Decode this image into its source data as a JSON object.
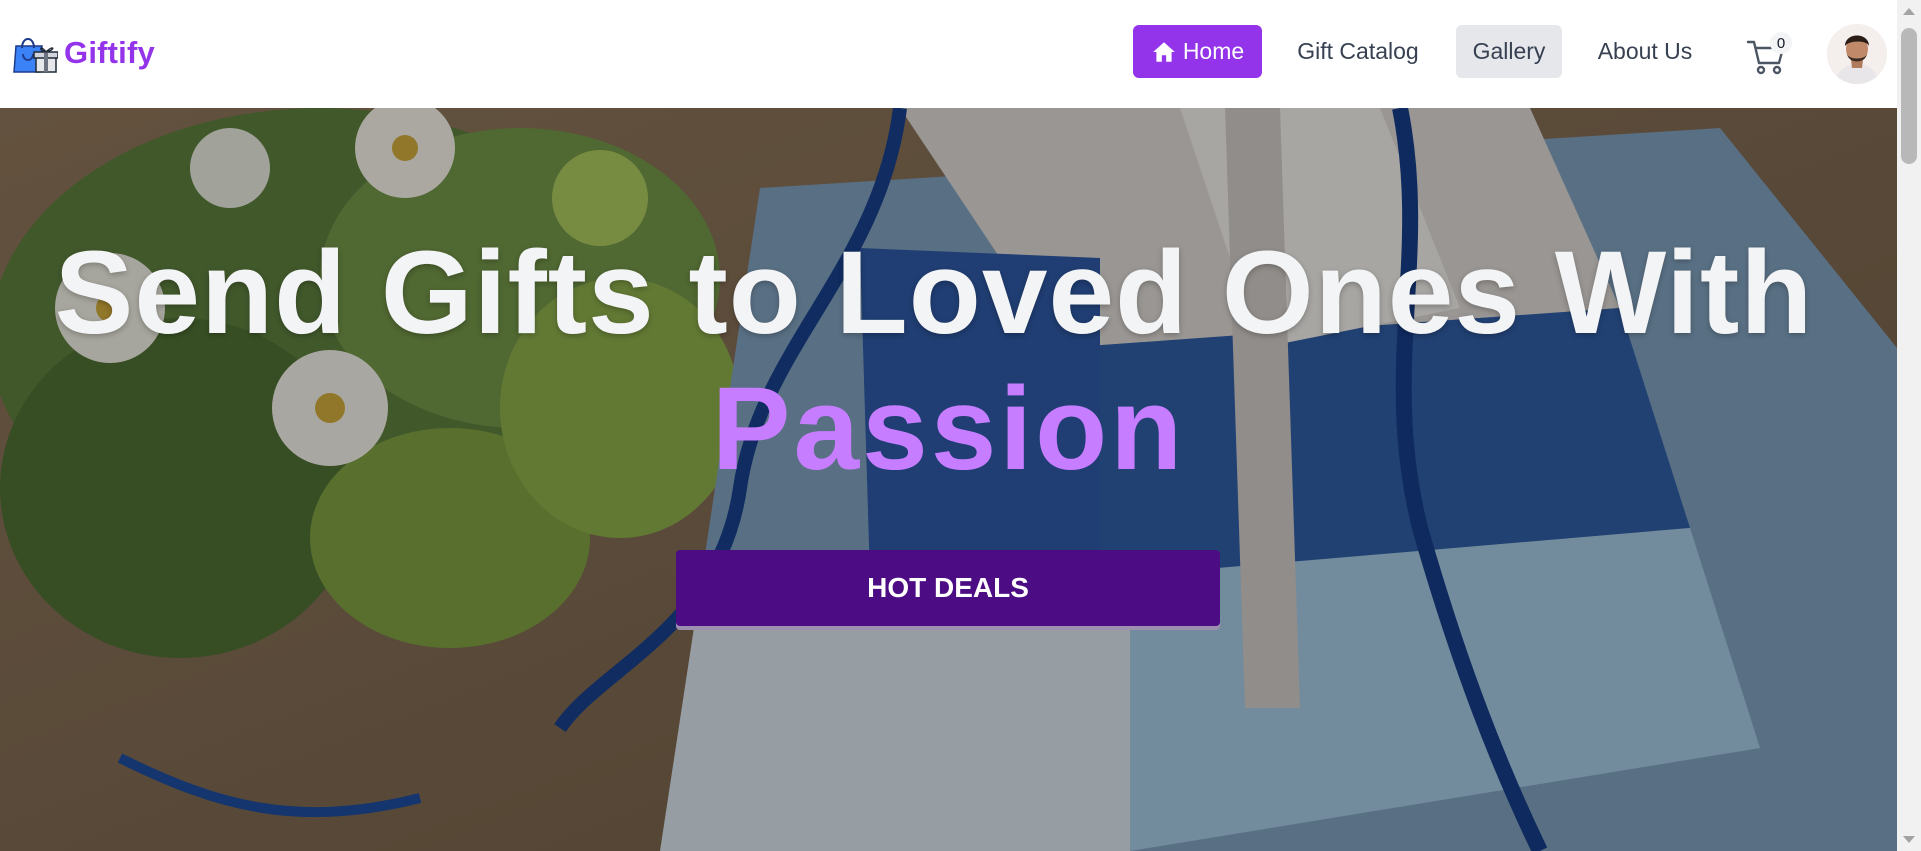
{
  "brand": {
    "name": "Giftify",
    "icon": "shopping-bag-gift-icon",
    "color": "#9333ea"
  },
  "nav": {
    "items": [
      {
        "label": "Home",
        "icon": "home-icon",
        "active": true
      },
      {
        "label": "Gift Catalog"
      },
      {
        "label": "Gallery",
        "hovered": true
      },
      {
        "label": "About Us"
      }
    ],
    "cart": {
      "icon": "shopping-cart-icon",
      "count": "0"
    },
    "avatar": "user-avatar"
  },
  "hero": {
    "title": "Send Gifts to Loved Ones With",
    "accent": "Passion",
    "cta_label": "HOT DEALS",
    "colors": {
      "title": "#f3f4f6",
      "accent": "#c77dff",
      "cta_bg": "#4c0d84"
    }
  }
}
